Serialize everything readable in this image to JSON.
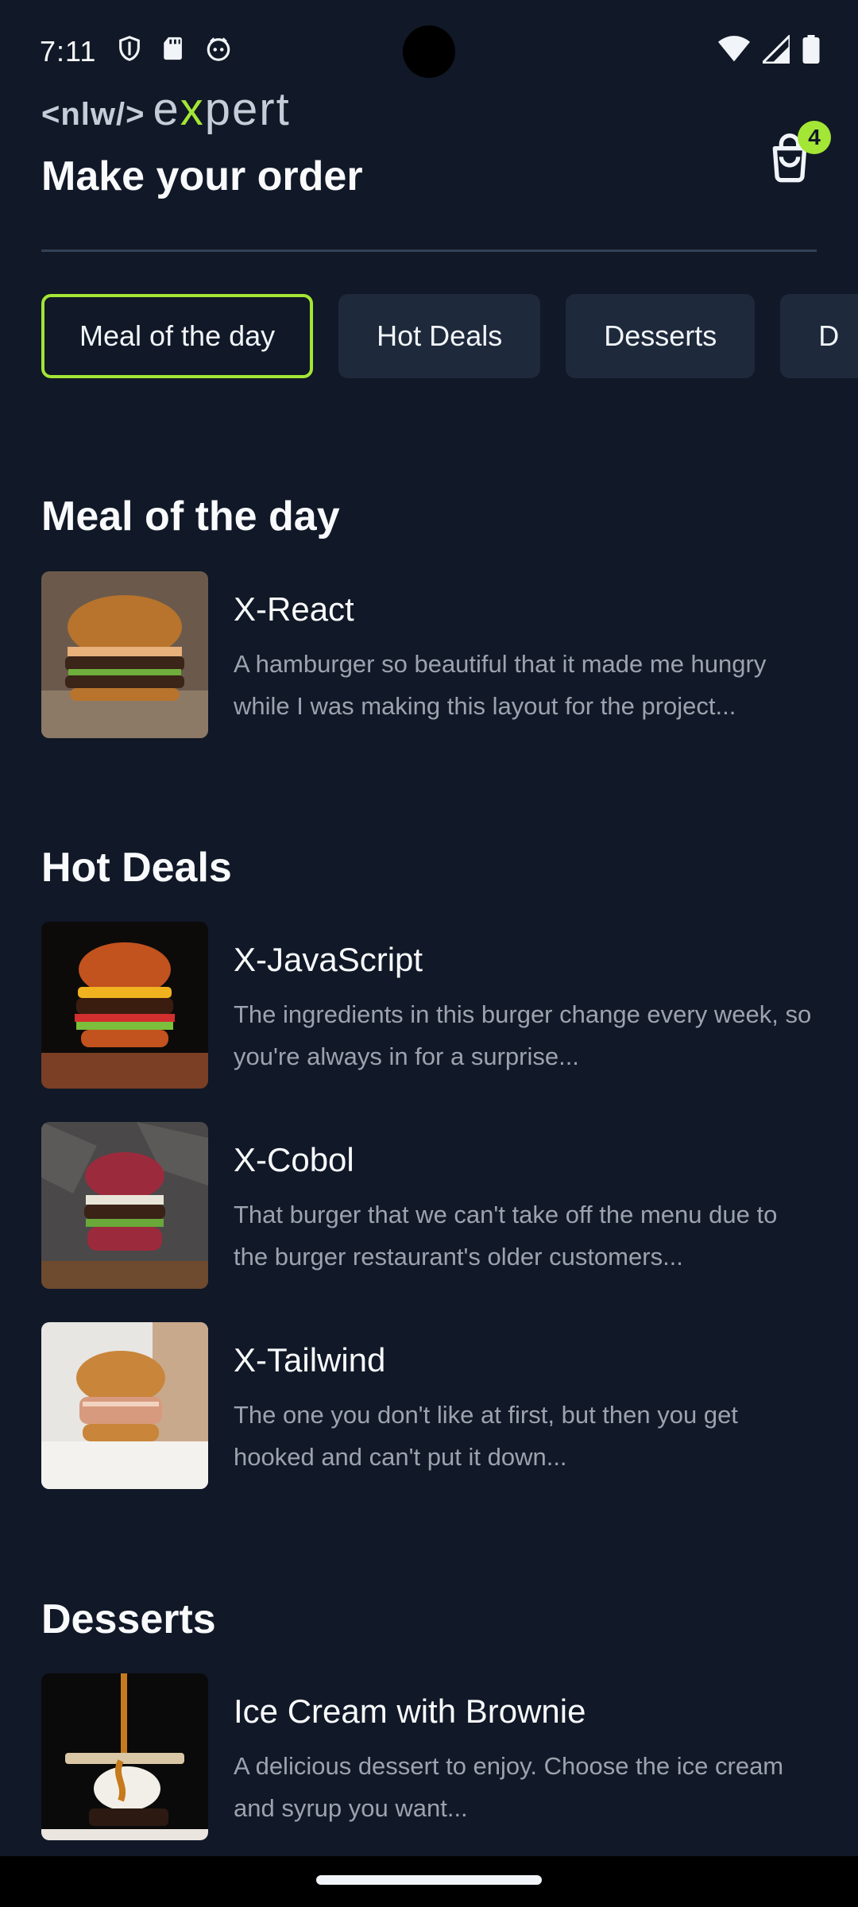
{
  "status_bar": {
    "time": "7:11"
  },
  "header": {
    "logo_prefix": "<nlw/>",
    "logo_word_a": "e",
    "logo_word_x": "x",
    "logo_word_b": "pert",
    "title": "Make your order",
    "cart_count": "4"
  },
  "tabs": [
    {
      "label": "Meal of the day",
      "active": true
    },
    {
      "label": "Hot Deals",
      "active": false
    },
    {
      "label": "Desserts",
      "active": false
    },
    {
      "label": "D",
      "active": false
    }
  ],
  "sections": [
    {
      "title": "Meal of the day",
      "items": [
        {
          "name": "X-React",
          "description": "A hamburger so beautiful that it made me hungry while I was making this layout for the project..."
        }
      ]
    },
    {
      "title": "Hot Deals",
      "items": [
        {
          "name": "X-JavaScript",
          "description": "The ingredients in this burger change every week, so you're always in for a surprise..."
        },
        {
          "name": "X-Cobol",
          "description": "That burger that we can't take off the menu due to the burger restaurant's older customers..."
        },
        {
          "name": "X-Tailwind",
          "description": "The one you don't like at first, but then you get hooked and can't put it down..."
        }
      ]
    },
    {
      "title": "Desserts",
      "items": [
        {
          "name": "Ice Cream with Brownie",
          "description": "A delicious dessert to enjoy. Choose the ice cream and syrup you want..."
        }
      ]
    }
  ],
  "colors": {
    "background": "#111827",
    "accent": "#a3e635",
    "tab_bg": "#1e293b",
    "muted_text": "#9ca3af"
  }
}
